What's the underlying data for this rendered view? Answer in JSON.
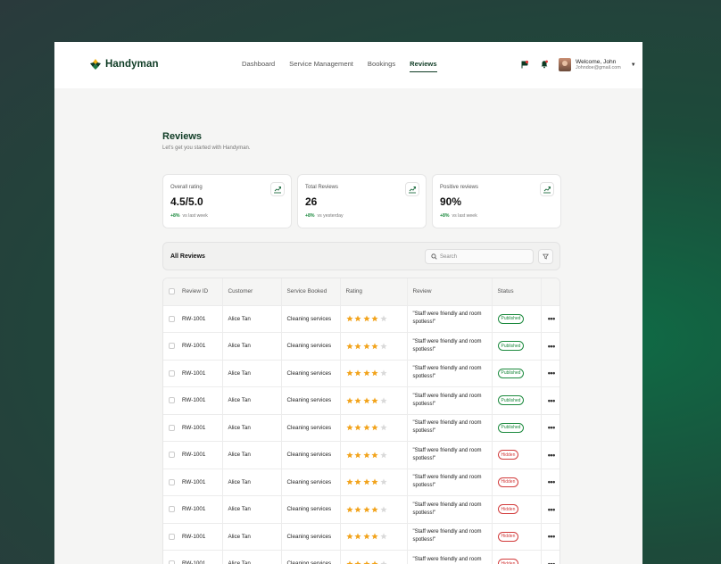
{
  "app": {
    "name": "Handyman"
  },
  "nav": [
    {
      "label": "Dashboard",
      "active": false
    },
    {
      "label": "Service Management",
      "active": false
    },
    {
      "label": "Bookings",
      "active": false
    },
    {
      "label": "Reviews",
      "active": true
    }
  ],
  "header": {
    "icons": [
      "flag-icon",
      "bell-icon"
    ],
    "user_name": "Welcome, John",
    "user_email": "Johndoe@gmail.com"
  },
  "page": {
    "title": "Reviews",
    "subtitle": "Let's get you started with Handyman."
  },
  "stats": [
    {
      "label": "Overall rating",
      "value": "4.5/5.0",
      "delta": "+8%",
      "compare": "vs last week"
    },
    {
      "label": "Total Reviews",
      "value": "26",
      "delta": "+8%",
      "compare": "vs yesterday"
    },
    {
      "label": "Positive reviews",
      "value": "90%",
      "delta": "+8%",
      "compare": "vs last week"
    }
  ],
  "reviews_panel": {
    "title": "All Reviews",
    "search_placeholder": "Search"
  },
  "table": {
    "columns": [
      "Review ID",
      "Customer",
      "Service Booked",
      "Rating",
      "Review",
      "Status"
    ],
    "rows": [
      {
        "id": "RW-1001",
        "customer": "Alice Tan",
        "service": "Cleaning services",
        "rating": 4,
        "review": "\"Staff were friendly and room spotless!\"",
        "status": "Published"
      },
      {
        "id": "RW-1001",
        "customer": "Alice Tan",
        "service": "Cleaning services",
        "rating": 4,
        "review": "\"Staff were friendly and room spotless!\"",
        "status": "Published"
      },
      {
        "id": "RW-1001",
        "customer": "Alice Tan",
        "service": "Cleaning services",
        "rating": 4,
        "review": "\"Staff were friendly and room spotless!\"",
        "status": "Published"
      },
      {
        "id": "RW-1001",
        "customer": "Alice Tan",
        "service": "Cleaning services",
        "rating": 4,
        "review": "\"Staff were friendly and room spotless!\"",
        "status": "Published"
      },
      {
        "id": "RW-1001",
        "customer": "Alice Tan",
        "service": "Cleaning services",
        "rating": 4,
        "review": "\"Staff were friendly and room spotless!\"",
        "status": "Published"
      },
      {
        "id": "RW-1001",
        "customer": "Alice Tan",
        "service": "Cleaning services",
        "rating": 4,
        "review": "\"Staff were friendly and room spotless!\"",
        "status": "Hidden"
      },
      {
        "id": "RW-1001",
        "customer": "Alice Tan",
        "service": "Cleaning services",
        "rating": 4,
        "review": "\"Staff were friendly and room spotless!\"",
        "status": "Hidden"
      },
      {
        "id": "RW-1001",
        "customer": "Alice Tan",
        "service": "Cleaning services",
        "rating": 4,
        "review": "\"Staff were friendly and room spotless!\"",
        "status": "Hidden"
      },
      {
        "id": "RW-1001",
        "customer": "Alice Tan",
        "service": "Cleaning services",
        "rating": 4,
        "review": "\"Staff were friendly and room spotless!\"",
        "status": "Hidden"
      },
      {
        "id": "RW-1001",
        "customer": "Alice Tan",
        "service": "Cleaning services",
        "rating": 4,
        "review": "\"Staff were friendly and room spotless!\"",
        "status": "Hidden"
      }
    ]
  },
  "colors": {
    "brand": "#0e3b24",
    "star_filled": "#f2a31b",
    "star_empty": "#d9d9d9",
    "published": "#1c8a3e",
    "hidden": "#d23b3b"
  }
}
